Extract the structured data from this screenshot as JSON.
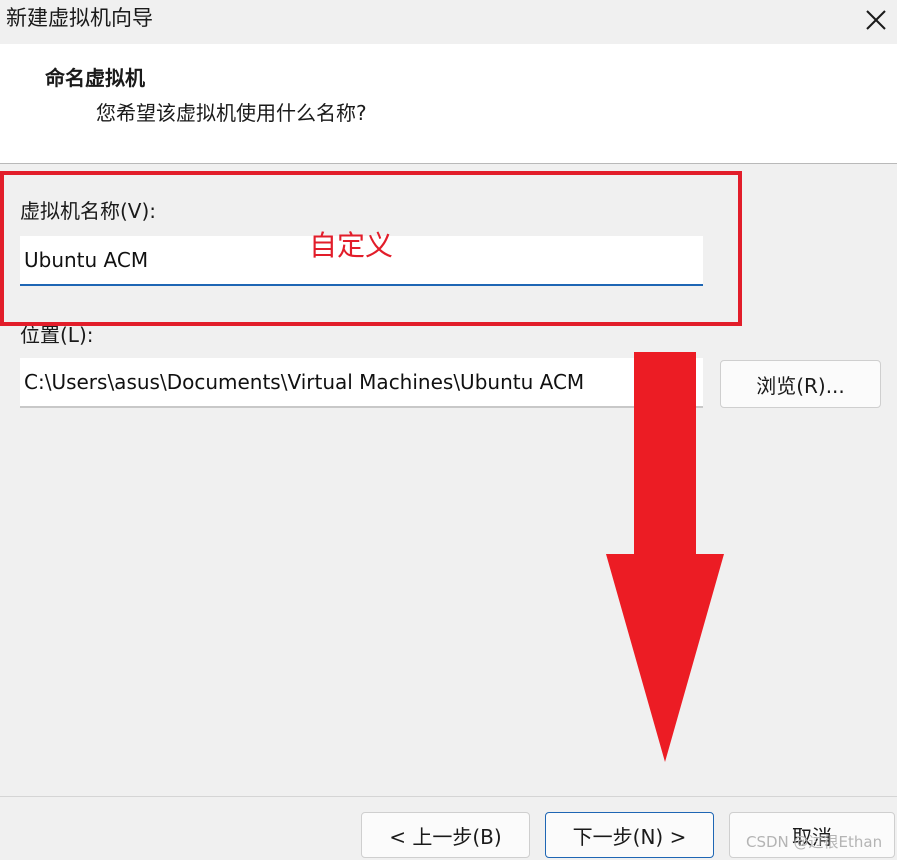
{
  "window": {
    "title": "新建虚拟机向导",
    "close_icon": "close-icon"
  },
  "header": {
    "title": "命名虚拟机",
    "subtitle": "您希望该虚拟机使用什么名称?"
  },
  "form": {
    "name_label": "虚拟机名称(V):",
    "name_value": "Ubuntu ACM",
    "location_label": "位置(L):",
    "location_value": "C:\\Users\\asus\\Documents\\Virtual Machines\\Ubuntu ACM",
    "browse_label": "浏览(R)..."
  },
  "footer": {
    "back_label": "< 上一步(B)",
    "next_label": "下一步(N) >",
    "cancel_label": "取消"
  },
  "annotation": {
    "text": "自定义",
    "color": "#e21d2a",
    "arrow_icon": "arrow-down-icon"
  },
  "watermark": {
    "text": "CSDN @过很Ethan"
  },
  "colors": {
    "accent": "#1e66b4",
    "window_bg": "#f0f0f0",
    "header_bg": "#ffffff"
  }
}
